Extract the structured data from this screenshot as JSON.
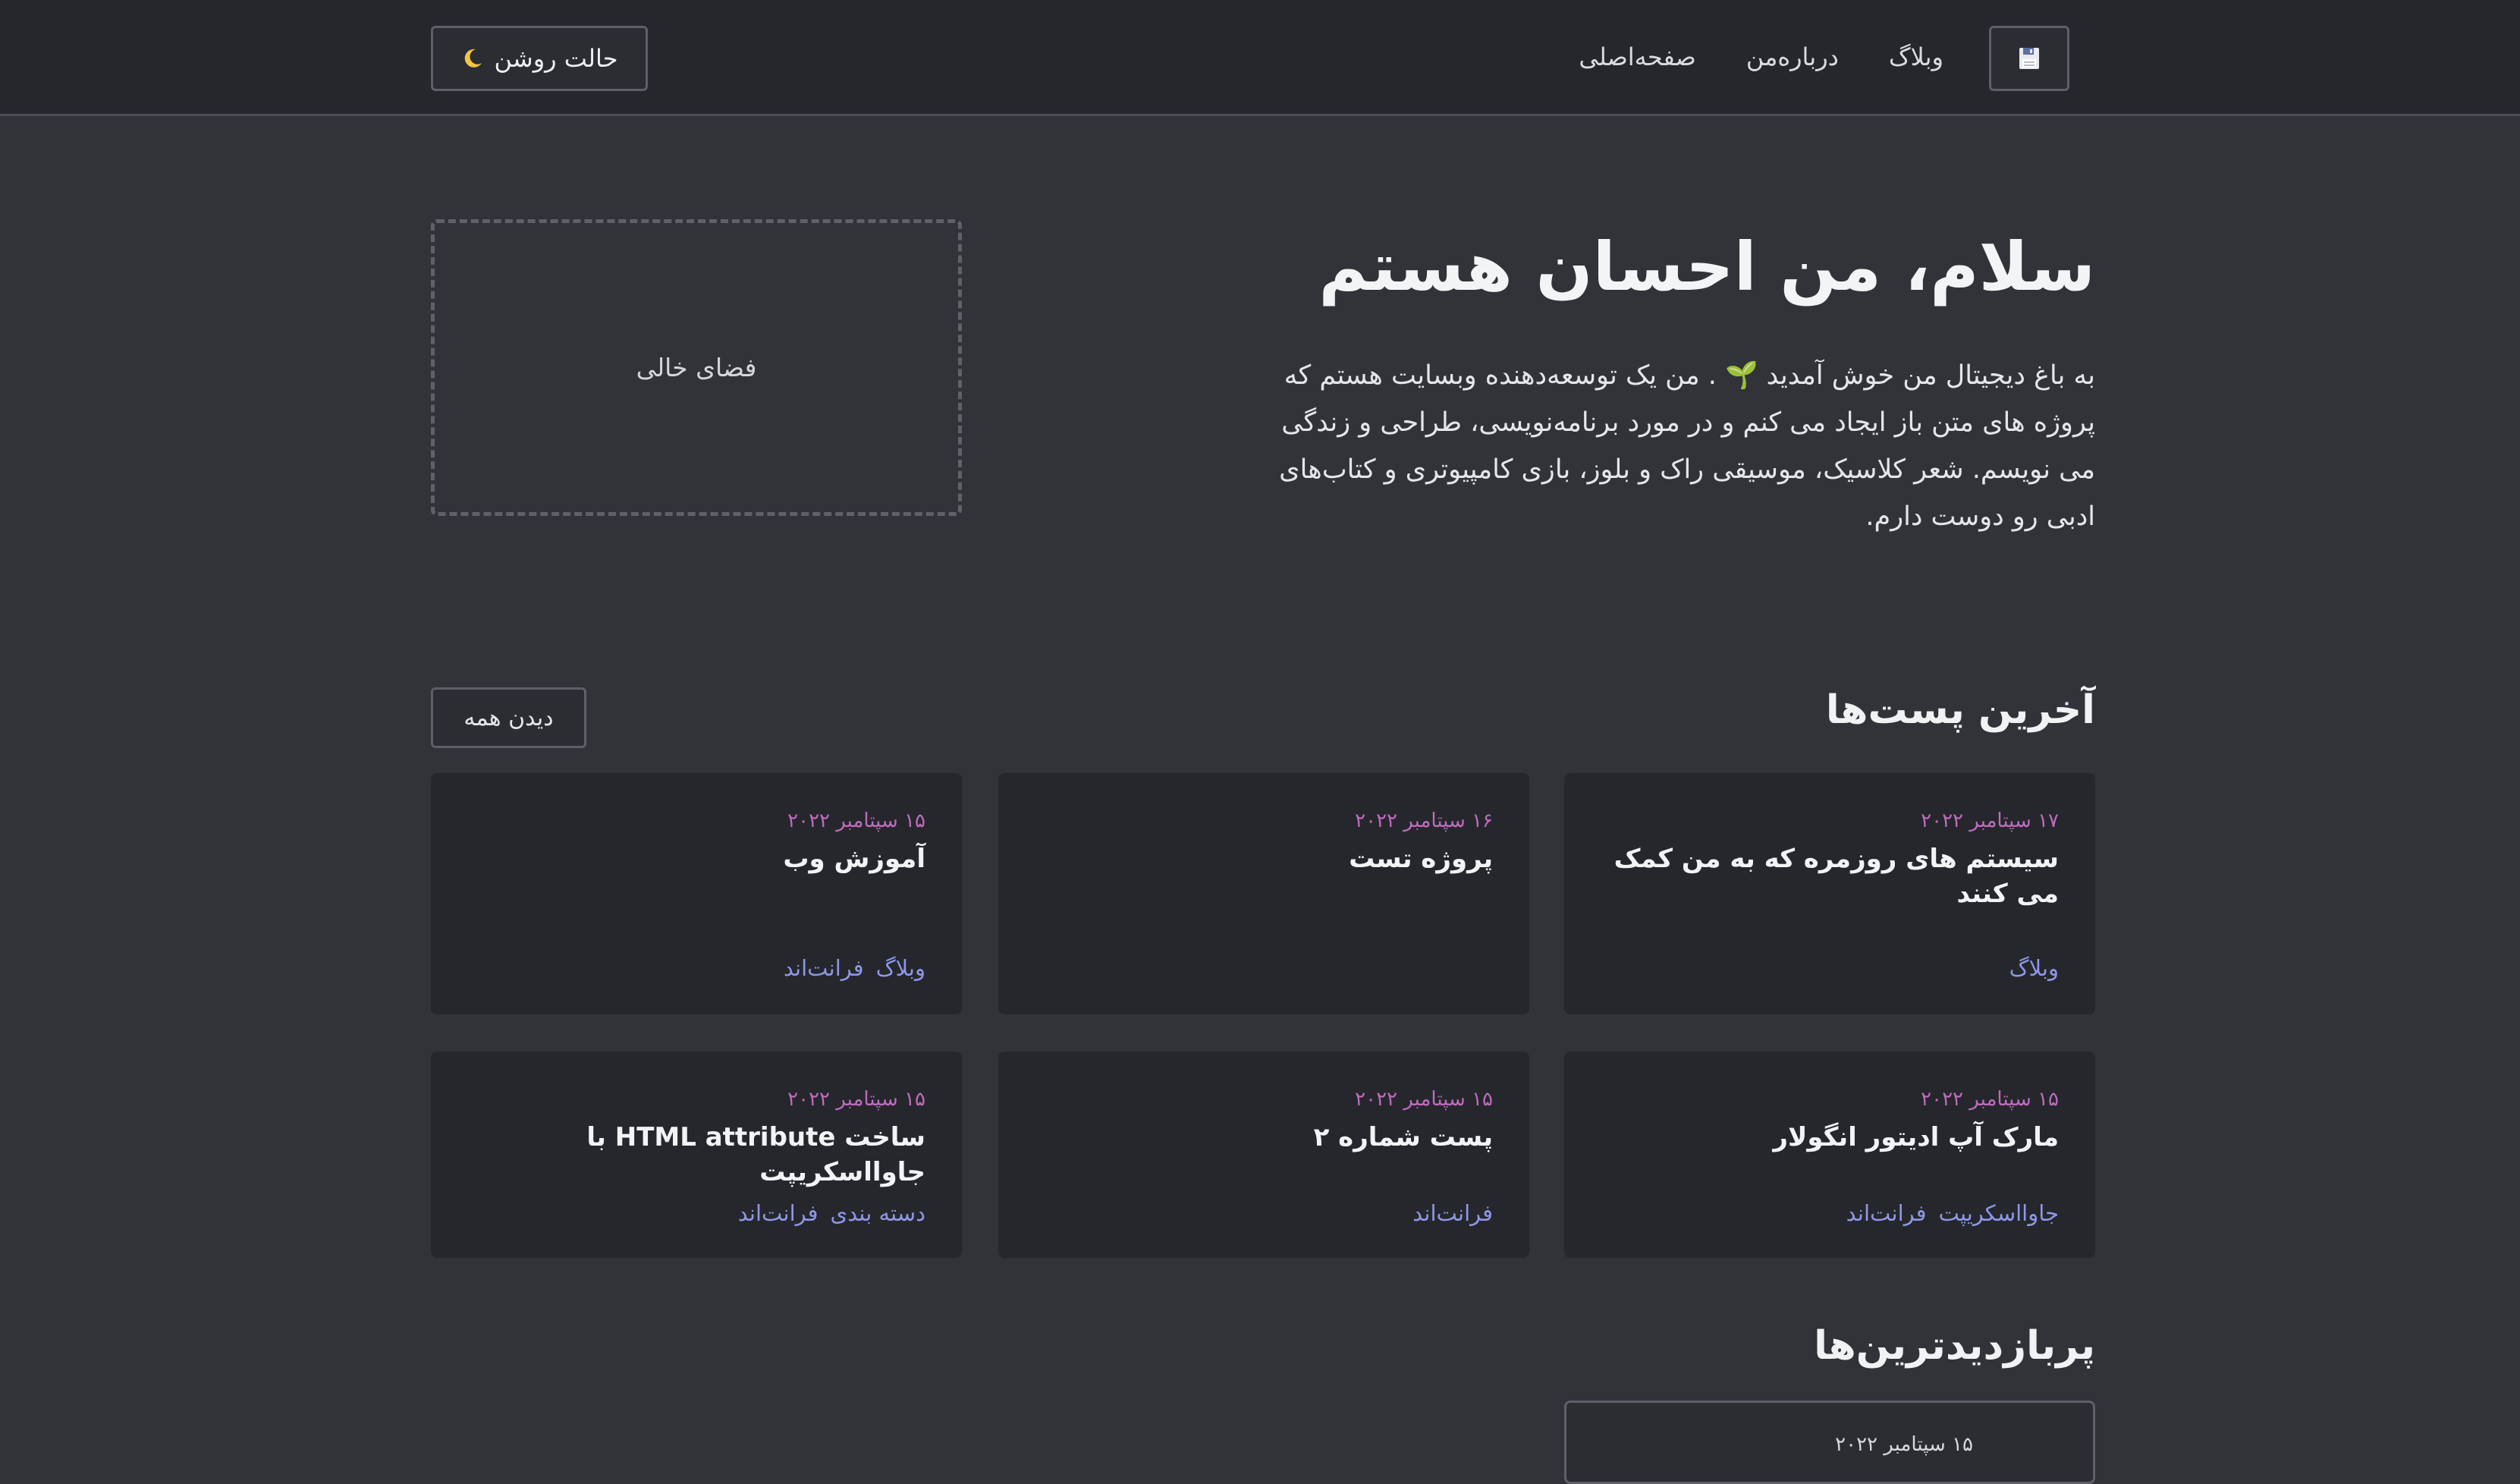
{
  "header": {
    "theme_toggle_label": "حالت روشن",
    "nav": {
      "home": "صفحه‌اصلی",
      "about": "درباره‌من",
      "blog": "وبلاگ"
    },
    "logo_icon": "floppy-disk-icon",
    "theme_icon": "crescent-moon-icon"
  },
  "hero": {
    "placeholder": "فضای خالی",
    "title": "سلام، من احسان هستم",
    "description": "به باغ دیجیتال من خوش آمدید 🌱 . من یک توسعه‌دهنده وبسایت هستم که پروژه های متن باز ایجاد می کنم و در مورد برنامه‌نویسی، طراحی و زندگی می نویسم. شعر کلاسیک، موسیقی راک و بلوز، بازی کامپیوتری و کتاب‌های ادبی رو دوست دارم."
  },
  "latest": {
    "title": "آخرین پست‌ها",
    "see_all": "دیدن همه",
    "posts": [
      {
        "date": "۱۷ سپتامبر ۲۰۲۲",
        "title": "سیستم های روزمره که به من کمک می کنند",
        "tags": [
          "وبلاگ"
        ]
      },
      {
        "date": "۱۶ سپتامبر ۲۰۲۲",
        "title": "پروژه تست",
        "tags": []
      },
      {
        "date": "۱۵ سپتامبر ۲۰۲۲",
        "title": "آموزش وب",
        "tags": [
          "وبلاگ",
          "فرانت‌اند"
        ]
      },
      {
        "date": "۱۵ سپتامبر ۲۰۲۲",
        "title": "مارک آپ ادیتور انگولار",
        "tags": [
          "جاوااسکریپت",
          "فرانت‌اند"
        ]
      },
      {
        "date": "۱۵ سپتامبر ۲۰۲۲",
        "title": "پست شماره ۲",
        "tags": [
          "فرانت‌اند"
        ]
      },
      {
        "date": "۱۵ سپتامبر ۲۰۲۲",
        "title": "ساخت HTML attribute با جاوااسکریپت",
        "tags": [
          "دسته بندی",
          "فرانت‌اند"
        ]
      }
    ]
  },
  "popular": {
    "title": "پربازدیدترین‌ها",
    "posts": [
      {
        "date": "۱۵ سپتامبر ۲۰۲۲"
      }
    ]
  },
  "colors": {
    "background": "#313338",
    "header": "#25272c",
    "card": "#25272c",
    "date_accent": "#c06bbd",
    "tag_accent": "#8e97e8"
  }
}
